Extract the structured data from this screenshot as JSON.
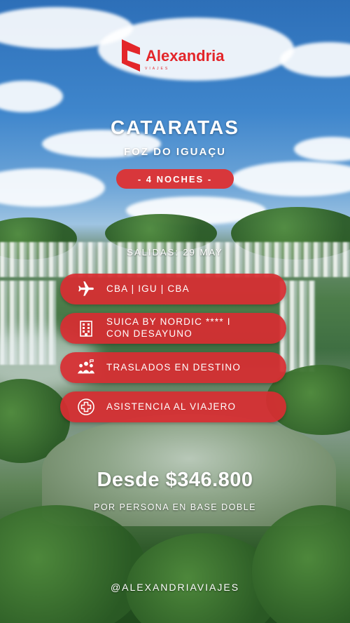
{
  "brand": {
    "name": "Alexandria",
    "tagline": "VIAJES",
    "accent": "#e3262a"
  },
  "trip": {
    "title": "CATARATAS",
    "subtitle": "FOZ DO IGUAÇU",
    "nights": "- 4 NOCHES -",
    "departures": "SALIDAS: 29 MAY"
  },
  "features": [
    {
      "icon": "airplane-icon",
      "label": "CBA | IGU | CBA"
    },
    {
      "icon": "hotel-icon",
      "label": "SUICA BY NORDIC **** I",
      "label2": "CON DESAYUNO"
    },
    {
      "icon": "transfer-icon",
      "label": "TRASLADOS EN DESTINO"
    },
    {
      "icon": "medical-cross-icon",
      "label": "ASISTENCIA AL VIAJERO"
    }
  ],
  "price": {
    "main": "Desde $346.800",
    "sub": "POR PERSONA EN BASE DOBLE"
  },
  "social": {
    "handle": "@ALEXANDRIAVIAJES"
  },
  "colors": {
    "pill": "#d72d32",
    "text": "#ffffff"
  }
}
